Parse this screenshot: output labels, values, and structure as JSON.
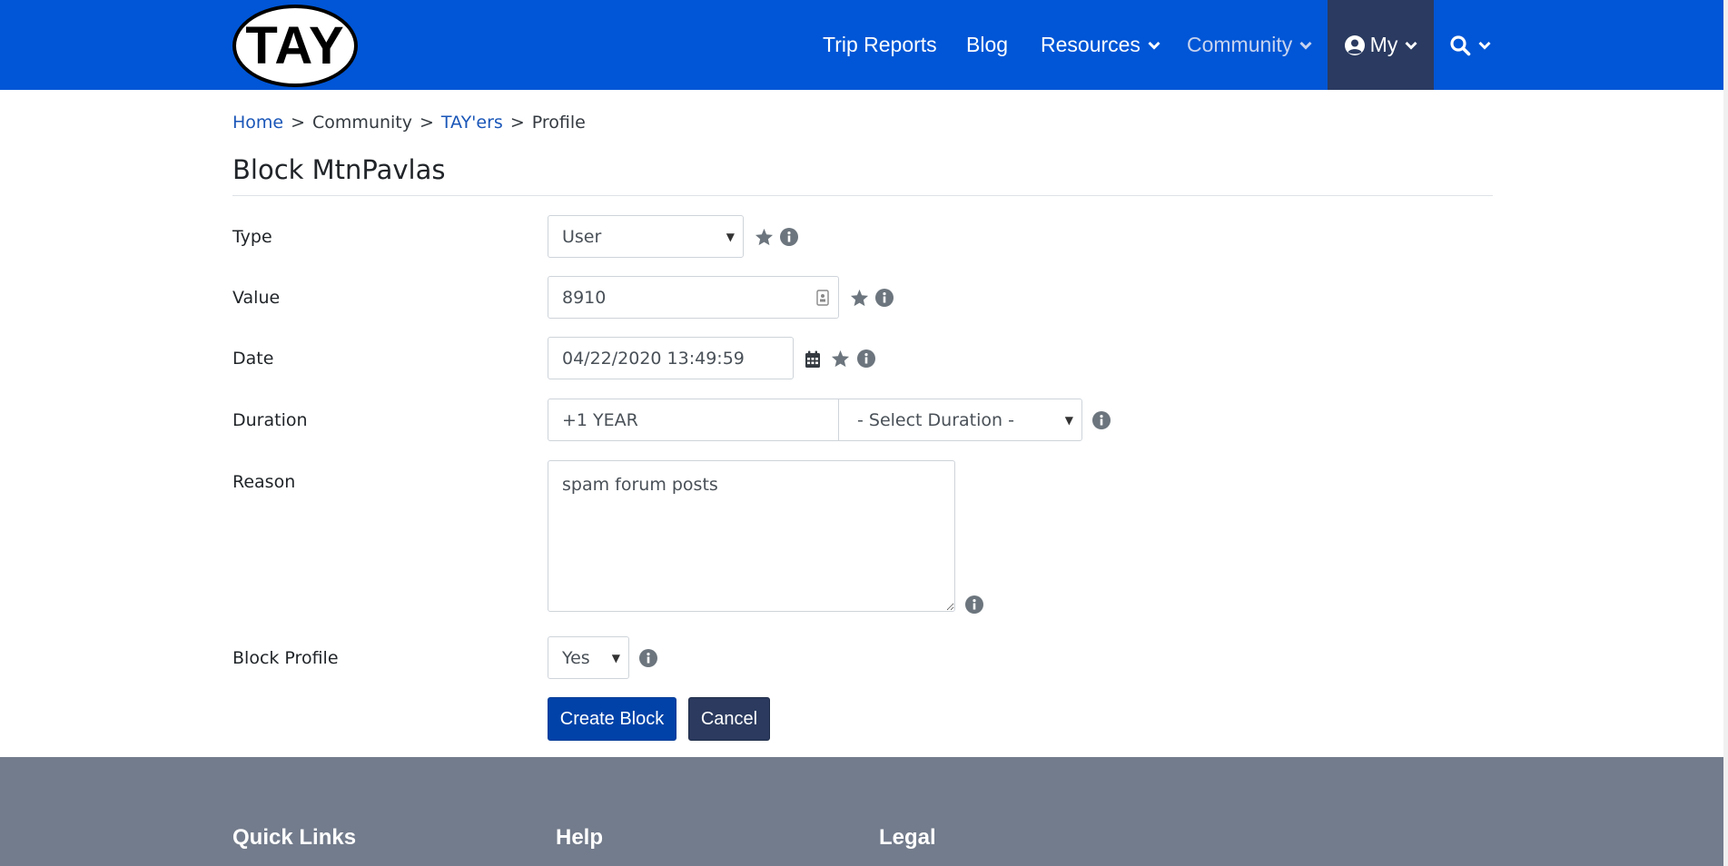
{
  "header": {
    "logo_text": "TAY",
    "nav": {
      "trip_reports": "Trip Reports",
      "blog": "Blog",
      "resources": "Resources",
      "community": "Community",
      "my": "My"
    },
    "colors": {
      "bar": "#0056d6",
      "active_item": "#2a3a60"
    }
  },
  "breadcrumb": {
    "home": "Home",
    "sep1": ">",
    "community": "Community",
    "sep2": ">",
    "tayers": "TAY'ers",
    "sep3": ">",
    "profile": "Profile"
  },
  "page_title": "Block MtnPavlas",
  "form": {
    "type": {
      "label": "Type",
      "value": "User"
    },
    "value": {
      "label": "Value",
      "value": "8910"
    },
    "date": {
      "label": "Date",
      "value": "04/22/2020 13:49:59"
    },
    "duration": {
      "label": "Duration",
      "value": "+1 YEAR",
      "select_value": "- Select Duration -"
    },
    "reason": {
      "label": "Reason",
      "value": "spam forum posts"
    },
    "block_profile": {
      "label": "Block Profile",
      "value": "Yes"
    },
    "submit_label": "Create Block",
    "cancel_label": "Cancel"
  },
  "footer": {
    "quick_links": "Quick Links",
    "help": "Help",
    "legal": "Legal",
    "color": "#737c8c"
  },
  "icons": [
    "user-circle-icon",
    "chevron-down-icon",
    "search-icon",
    "star-icon",
    "info-icon",
    "calendar-icon",
    "contact-card-icon"
  ]
}
